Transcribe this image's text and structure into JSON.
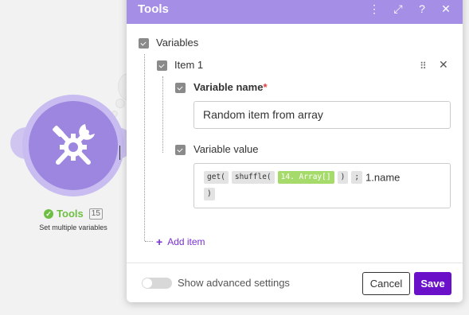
{
  "canvas": {
    "module": {
      "name": "Tools",
      "id_badge": "15",
      "subtitle": "Set multiple variables",
      "status_icon": "check-icon",
      "module_icon": "tools-icon",
      "color": "#9d86e0"
    }
  },
  "dialog": {
    "title": "Tools",
    "header_icons": [
      "more-vertical-icon",
      "expand-icon",
      "help-icon",
      "close-icon"
    ],
    "header_color": "#a58ee6",
    "variables_label": "Variables",
    "item": {
      "label": "Item 1",
      "drag_icon": "drag-handle-icon",
      "remove_icon": "remove-icon",
      "variable_name_label": "Variable name",
      "required_mark": "*",
      "variable_name_value": "Random item from array",
      "variable_value_label": "Variable value",
      "tokens": {
        "get": "get(",
        "shuffle": "shuffle(",
        "array": "14. Array[]",
        "close_paren": ")",
        "semicolon": ";",
        "path": "1.name",
        "close_brace": ")"
      }
    },
    "add_item_label": "Add item",
    "footer": {
      "advanced_label": "Show advanced settings",
      "advanced_enabled": false,
      "cancel_label": "Cancel",
      "save_label": "Save",
      "accent": "#6b10c9"
    }
  }
}
